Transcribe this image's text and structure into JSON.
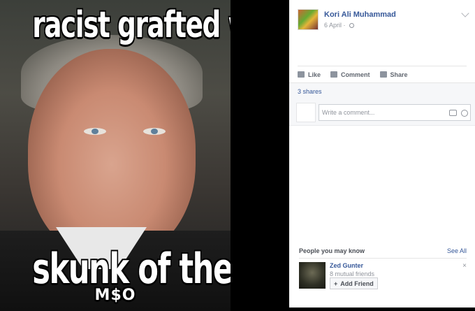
{
  "photo": {
    "meme_top": "racist grafted white devil",
    "meme_bottom": "skunk of the earth",
    "meme_signature": "M$O"
  },
  "post": {
    "author": "Kori Ali Muhammad",
    "date": "6 April",
    "date_separator": "·",
    "actions": {
      "like": "Like",
      "comment": "Comment",
      "share": "Share"
    },
    "shares_count": "3 shares",
    "comment_placeholder": "Write a comment..."
  },
  "pymk": {
    "title": "People you may know",
    "see_all": "See All",
    "people": [
      {
        "name": "Zed Gunter",
        "mutual": "8 mutual friends",
        "add_label": "Add Friend"
      }
    ]
  },
  "colors": {
    "link": "#365899",
    "muted": "#90949c",
    "background": "#000000"
  }
}
